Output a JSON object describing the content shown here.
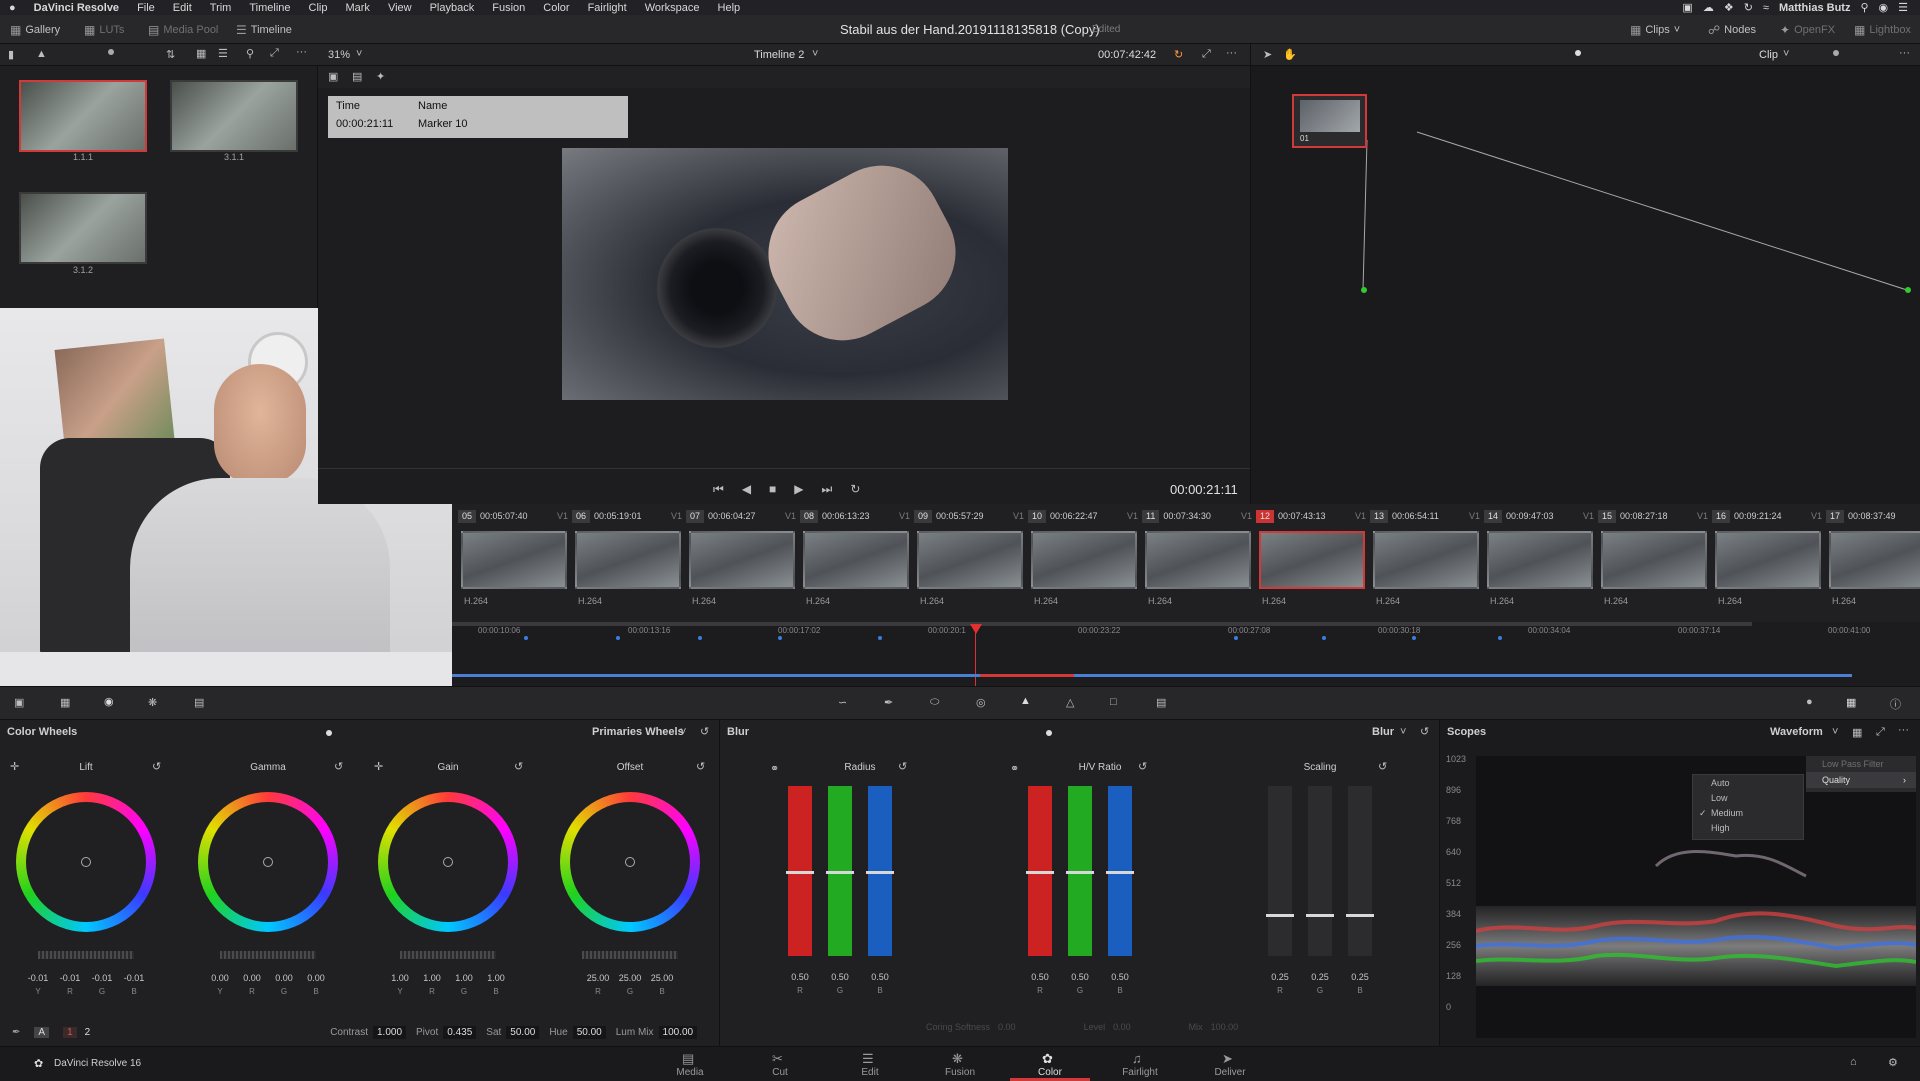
{
  "menubar": {
    "apple": "",
    "app_name": "DaVinci Resolve",
    "items": [
      "File",
      "Edit",
      "Trim",
      "Timeline",
      "Clip",
      "Mark",
      "View",
      "Playback",
      "Fusion",
      "Color",
      "Fairlight",
      "Workspace",
      "Help"
    ],
    "user": "Matthias Butz"
  },
  "toolbar": {
    "gallery": "Gallery",
    "luts": "LUTs",
    "media_pool": "Media Pool",
    "timeline": "Timeline",
    "project_title": "Stabil aus der Hand.20191118135818 (Copy)",
    "project_state": "Edited",
    "clips": "Clips",
    "nodes": "Nodes",
    "openfx": "OpenFX",
    "lightbox": "Lightbox"
  },
  "gallery": {
    "stills": [
      {
        "label": "1.1.1"
      },
      {
        "label": "3.1.1"
      },
      {
        "label": "3.1.2"
      }
    ]
  },
  "viewer": {
    "zoom": "31%",
    "timeline_name": "Timeline 2",
    "top_timecode": "00:07:42:42",
    "marker": {
      "time_label": "Time",
      "name_label": "Name",
      "time_value": "00:00:21:11",
      "name_value": "Marker 10"
    },
    "timecode": "00:00:21:11"
  },
  "nodes_panel": {
    "mode": "Clip",
    "node_label": "01"
  },
  "clips": [
    {
      "num": "05",
      "tc": "00:05:07:40",
      "track": "V1",
      "codec": "H.264"
    },
    {
      "num": "06",
      "tc": "00:05:19:01",
      "track": "V1",
      "codec": "H.264"
    },
    {
      "num": "07",
      "tc": "00:06:04:27",
      "track": "V1",
      "codec": "H.264"
    },
    {
      "num": "08",
      "tc": "00:06:13:23",
      "track": "V1",
      "codec": "H.264"
    },
    {
      "num": "09",
      "tc": "00:05:57:29",
      "track": "V1",
      "codec": "H.264"
    },
    {
      "num": "10",
      "tc": "00:06:22:47",
      "track": "V1",
      "codec": "H.264"
    },
    {
      "num": "11",
      "tc": "00:07:34:30",
      "track": "V1",
      "codec": "H.264"
    },
    {
      "num": "12",
      "tc": "00:07:43:13",
      "track": "V1",
      "codec": "H.264"
    },
    {
      "num": "13",
      "tc": "00:06:54:11",
      "track": "V1",
      "codec": "H.264"
    },
    {
      "num": "14",
      "tc": "00:09:47:03",
      "track": "V1",
      "codec": "H.264"
    },
    {
      "num": "15",
      "tc": "00:08:27:18",
      "track": "V1",
      "codec": "H.264"
    },
    {
      "num": "16",
      "tc": "00:09:21:24",
      "track": "V1",
      "codec": "H.264"
    },
    {
      "num": "17",
      "tc": "00:08:37:49",
      "track": "V1",
      "codec": "H.264"
    }
  ],
  "mini_timeline": {
    "ticks": [
      "00:00:10:06",
      "00:00:13:16",
      "00:00:17:02",
      "00:00:20:1",
      "00:00:23:22",
      "00:00:27:08",
      "00:00:30:18",
      "00:00:34:04",
      "00:00:37:14",
      "00:00:41:00"
    ]
  },
  "color_wheels": {
    "title": "Color Wheels",
    "mode": "Primaries Wheels",
    "wheels": [
      {
        "label": "Lift",
        "values": [
          "-0.01",
          "-0.01",
          "-0.01",
          "-0.01"
        ]
      },
      {
        "label": "Gamma",
        "values": [
          "0.00",
          "0.00",
          "0.00",
          "0.00"
        ]
      },
      {
        "label": "Gain",
        "values": [
          "1.00",
          "1.00",
          "1.00",
          "1.00"
        ]
      },
      {
        "label": "Offset",
        "values": [
          "25.00",
          "25.00",
          "25.00"
        ]
      }
    ],
    "channels4": [
      "Y",
      "R",
      "G",
      "B"
    ],
    "channels3": [
      "R",
      "G",
      "B"
    ],
    "params": {
      "page_1": "1",
      "page_2": "2",
      "contrast_label": "Contrast",
      "contrast": "1.000",
      "pivot_label": "Pivot",
      "pivot": "0.435",
      "sat_label": "Sat",
      "sat": "50.00",
      "hue_label": "Hue",
      "hue": "50.00",
      "lummix_label": "Lum Mix",
      "lummix": "100.00"
    }
  },
  "blur": {
    "title": "Blur",
    "mode": "Blur",
    "radius_label": "Radius",
    "radius_values": [
      "0.50",
      "0.50",
      "0.50"
    ],
    "radius_level": 0.5,
    "hv_label": "H/V Ratio",
    "hv_values": [
      "0.50",
      "0.50",
      "0.50"
    ],
    "hv_level": 0.5,
    "scaling_label": "Scaling",
    "scaling_values": [
      "0.25",
      "0.25",
      "0.25"
    ],
    "scaling_level": 0.25,
    "channels": [
      "R",
      "G",
      "B"
    ],
    "params": {
      "coring_label": "Coring Softness",
      "coring": "0.00",
      "level_label": "Level",
      "level": "0.00",
      "mix_label": "Mix",
      "mix": "100.00"
    }
  },
  "scopes": {
    "title": "Scopes",
    "mode": "Waveform",
    "y_labels": [
      "1023",
      "896",
      "768",
      "640",
      "512",
      "384",
      "256",
      "128",
      "0"
    ],
    "submenu": {
      "low_pass": "Low Pass Filter",
      "quality": "Quality"
    },
    "quality_options": [
      "Auto",
      "Low",
      "Medium",
      "High"
    ],
    "quality_selected": "Medium"
  },
  "footer": {
    "app_label": "DaVinci Resolve 16",
    "pages": [
      "Media",
      "Cut",
      "Edit",
      "Fusion",
      "Color",
      "Fairlight",
      "Deliver"
    ],
    "active_page": "Color"
  },
  "colors": {
    "accent": "#d23a3a",
    "red_bar": "#cc2222",
    "green_bar": "#22aa22",
    "blue_bar": "#1a5fbf"
  }
}
